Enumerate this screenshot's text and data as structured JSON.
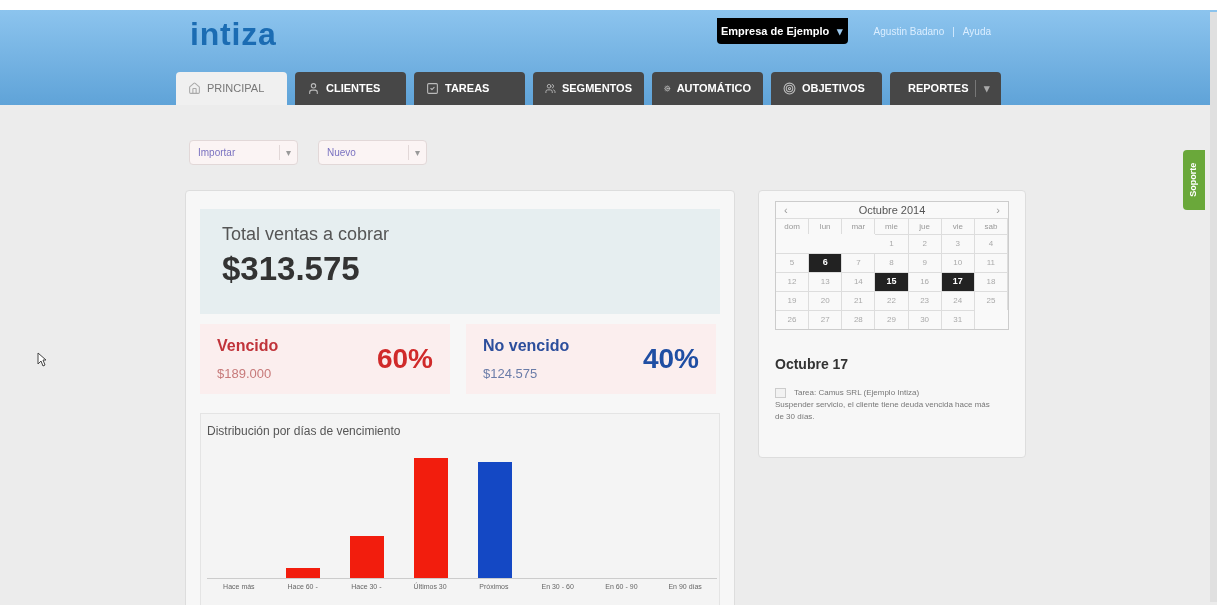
{
  "header": {
    "logo": "intiza",
    "company": "Empresa de Ejemplo",
    "company_caret": "▾",
    "user": "Agustin Badano",
    "separator": "|",
    "help": "Ayuda"
  },
  "tabs": [
    {
      "label": "PRINCIPAL",
      "selected": true
    },
    {
      "label": "CLIENTES",
      "selected": false
    },
    {
      "label": "TAREAS",
      "selected": false
    },
    {
      "label": "SEGMENTOS",
      "selected": false
    },
    {
      "label": "AUTOMÁTICO",
      "selected": false
    },
    {
      "label": "OBJETIVOS",
      "selected": false
    },
    {
      "label": "REPORTES",
      "selected": false,
      "caret": "▾"
    }
  ],
  "actions": [
    {
      "label": "Importar",
      "caret": "▾"
    },
    {
      "label": "Nuevo",
      "caret": "▾"
    }
  ],
  "total": {
    "label": "Total ventas a cobrar",
    "value": "$313.575"
  },
  "split": [
    {
      "kind": "overdue",
      "label": "Vencido",
      "amount": "$189.000",
      "percent": "60%"
    },
    {
      "kind": "pending",
      "label": "No vencido",
      "amount": "$124.575",
      "percent": "40%"
    }
  ],
  "chart": {
    "title": "Distribución por días de vencimiento",
    "categories": [
      "Hace más",
      "Hace 60 -",
      "Hace 30 -",
      "Últimos 30",
      "Próximos",
      "En 30 - 60",
      "En 60 - 90",
      "En 90 días"
    ]
  },
  "calendar": {
    "prev": "‹",
    "title": "Octubre 2014",
    "next": "›",
    "weekdays": [
      "dom",
      "lun",
      "mar",
      "mie",
      "jue",
      "vie",
      "sab"
    ],
    "weeks": [
      [
        {
          "day": "1",
          "highlighted": false
        },
        {
          "day": "2",
          "highlighted": false
        },
        {
          "day": "3",
          "highlighted": false
        },
        {
          "day": "4",
          "highlighted": false
        }
      ],
      [
        {
          "day": "5",
          "highlighted": false
        },
        {
          "day": "6",
          "highlighted": true
        },
        {
          "day": "7",
          "highlighted": false
        },
        {
          "day": "8",
          "highlighted": false
        },
        {
          "day": "9",
          "highlighted": false
        },
        {
          "day": "10",
          "highlighted": false
        },
        {
          "day": "11",
          "highlighted": false
        }
      ],
      [
        {
          "day": "12",
          "highlighted": false
        },
        {
          "day": "13",
          "highlighted": false
        },
        {
          "day": "14",
          "highlighted": false
        },
        {
          "day": "15",
          "highlighted": true
        },
        {
          "day": "16",
          "highlighted": false
        },
        {
          "day": "17",
          "highlighted": true
        },
        {
          "day": "18",
          "highlighted": false
        }
      ],
      [
        {
          "day": "19",
          "highlighted": false
        },
        {
          "day": "20",
          "highlighted": false
        },
        {
          "day": "21",
          "highlighted": false
        },
        {
          "day": "22",
          "highlighted": false
        },
        {
          "day": "23",
          "highlighted": false
        },
        {
          "day": "24",
          "highlighted": false
        },
        {
          "day": "25",
          "highlighted": false
        }
      ],
      [
        {
          "day": "26",
          "highlighted": false
        },
        {
          "day": "27",
          "highlighted": false
        },
        {
          "day": "28",
          "highlighted": false
        },
        {
          "day": "29",
          "highlighted": false
        },
        {
          "day": "30",
          "highlighted": false
        },
        {
          "day": "31",
          "highlighted": false
        }
      ]
    ]
  },
  "agenda": {
    "date": "Octubre 17",
    "task": {
      "title": "Tarea: Camus SRL (Ejemplo Intiza)",
      "checked": false,
      "description": "Suspender servicio, el cliente tiene deuda vencida hace más de 30 días."
    }
  },
  "support_tab": "Soporte"
}
